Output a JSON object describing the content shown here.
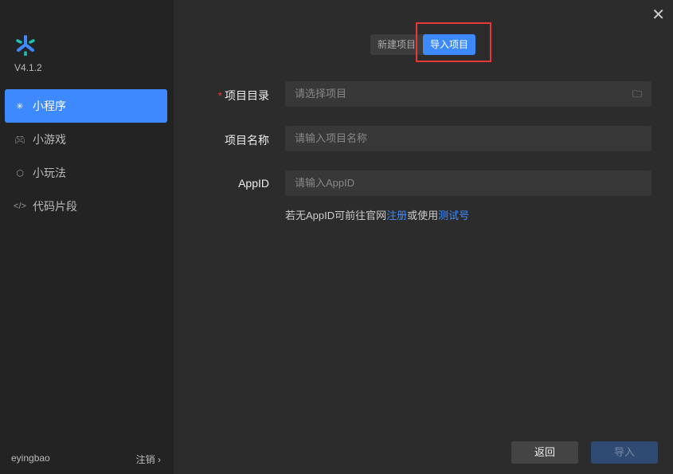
{
  "sidebar": {
    "version": "V4.1.2",
    "items": [
      {
        "label": "小程序",
        "icon": "miniprogram-icon"
      },
      {
        "label": "小游戏",
        "icon": "gamepad-icon"
      },
      {
        "label": "小玩法",
        "icon": "cube-icon"
      },
      {
        "label": "代码片段",
        "icon": "code-icon"
      }
    ],
    "user": "eyingbao",
    "logout": "注销"
  },
  "tabs": {
    "new": "新建项目",
    "import": "导入项目"
  },
  "form": {
    "dir_label": "项目目录",
    "dir_placeholder": "请选择项目",
    "name_label": "项目名称",
    "name_placeholder": "请输入项目名称",
    "appid_label": "AppID",
    "appid_placeholder": "请输入AppID",
    "hint_prefix": "若无AppID可前往官网",
    "hint_register": "注册",
    "hint_mid": "或使用",
    "hint_test": "测试号"
  },
  "buttons": {
    "back": "返回",
    "import": "导入"
  },
  "colors": {
    "accent": "#3d8afe",
    "highlight": "#e53935"
  }
}
